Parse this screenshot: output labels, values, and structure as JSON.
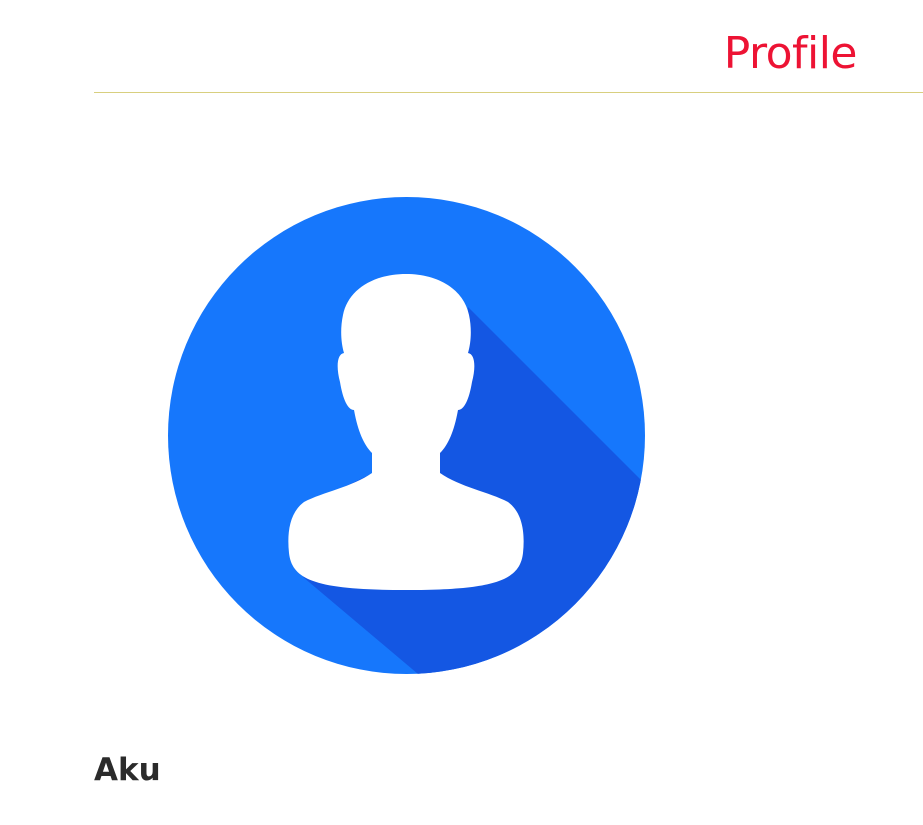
{
  "header": {
    "title": "Profile",
    "title_color": "#ed1334",
    "divider_color": "#d8cf7f"
  },
  "profile": {
    "avatar_icon": "user-avatar-icon",
    "avatar_colors": {
      "background": "#1677fc",
      "shadow": "#1457e3",
      "silhouette": "#ffffff"
    },
    "username": "Aku"
  }
}
